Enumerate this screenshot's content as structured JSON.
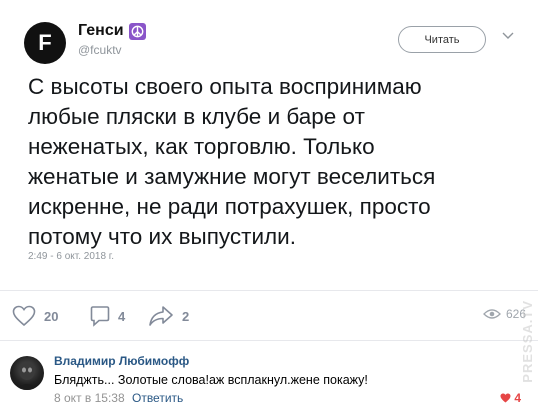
{
  "tweet": {
    "avatar_letter": "F",
    "author_name": "Генси",
    "badge_icon": "peace-icon",
    "handle": "@fcuktv",
    "follow_label": "Читать",
    "text": "С высоты своего опыта воспринимаю\nлюбые пляски в клубе и баре от\nнеженатых, как торговлю. Только\nженатые и замужние могут веселиться\nискренне, не ради потрахушек, просто\nпотому что их выпустили.",
    "date": "2:49 - 6 окт. 2018 г."
  },
  "actions": {
    "likes": "20",
    "comments": "4",
    "shares": "2",
    "views": "626"
  },
  "comment": {
    "author": "Владимир Любимофф",
    "text": "Бляджть... Золотые слова!аж всплакнул.жене покажу!",
    "date": "8 окт в 15:38",
    "reply_label": "Ответить",
    "likes": "4"
  },
  "watermark": "PRESSA.TV",
  "colors": {
    "link": "#2a5885",
    "like_red": "#e64646",
    "badge_purple": "#8a55c9"
  }
}
